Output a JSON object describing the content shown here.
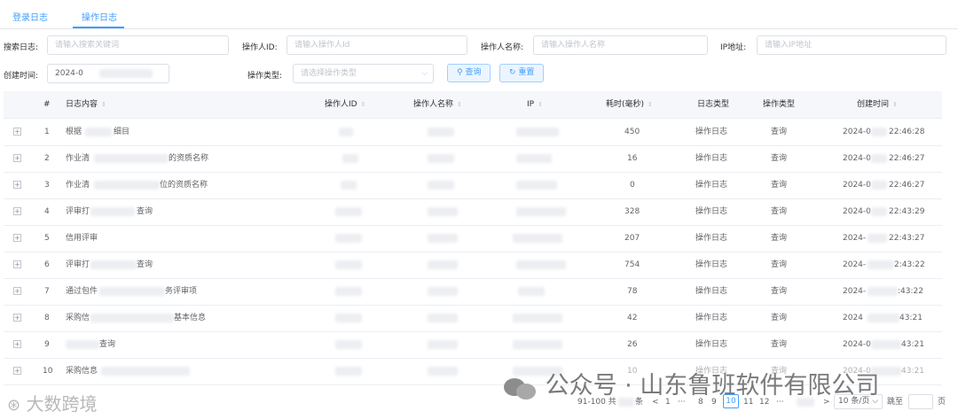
{
  "tabs": [
    "登录日志",
    "操作日志"
  ],
  "filters": {
    "search_label": "搜索日志:",
    "search_placeholder": "请输入搜索关键词",
    "operator_id_label": "操作人ID:",
    "operator_id_placeholder": "请输入操作人Id",
    "operator_name_label": "操作人名称:",
    "operator_name_placeholder": "请输入操作人名称",
    "ip_label": "IP地址:",
    "ip_placeholder": "请输入IP地址",
    "created_label": "创建时间:",
    "created_value": "2024-0",
    "op_type_label": "操作类型:",
    "op_type_placeholder": "请选择操作类型",
    "query_button": "查询",
    "reset_button": "重置"
  },
  "table": {
    "headers": [
      "#",
      "日志内容",
      "操作人ID",
      "操作人名称",
      "IP",
      "耗时(毫秒)",
      "日志类型",
      "操作类型",
      "创建时间"
    ],
    "rows": [
      {
        "index": "1",
        "content": "根据",
        "content2": "细目",
        "duration": "450",
        "log_type": "操作日志",
        "op_type": "查询",
        "time_prefix": "2024-0",
        "time_suffix": "22:46:28"
      },
      {
        "index": "2",
        "content": "作业清",
        "content2": "的资质名称",
        "duration": "16",
        "log_type": "操作日志",
        "op_type": "查询",
        "time_prefix": "2024-0",
        "time_suffix": "22:46:27"
      },
      {
        "index": "3",
        "content": "作业清",
        "content2": "位的资质名称",
        "duration": "0",
        "log_type": "操作日志",
        "op_type": "查询",
        "time_prefix": "2024-0",
        "time_suffix": "22:46:27"
      },
      {
        "index": "4",
        "content": "评审打",
        "content2": "查询",
        "duration": "328",
        "log_type": "操作日志",
        "op_type": "查询",
        "time_prefix": "2024-0",
        "time_suffix": "22:43:29"
      },
      {
        "index": "5",
        "content": "信用评审",
        "content2": "",
        "duration": "207",
        "log_type": "操作日志",
        "op_type": "查询",
        "time_prefix": "2024-",
        "time_suffix": "22:43:27"
      },
      {
        "index": "6",
        "content": "评审打",
        "content2": "查询",
        "duration": "754",
        "log_type": "操作日志",
        "op_type": "查询",
        "time_prefix": "2024-",
        "time_suffix": "2:43:22"
      },
      {
        "index": "7",
        "content": "通过包件",
        "content2": "务评审项",
        "duration": "78",
        "log_type": "操作日志",
        "op_type": "查询",
        "time_prefix": "2024-",
        "time_suffix": ":43:22"
      },
      {
        "index": "8",
        "content": "采购信",
        "content2": "基本信息",
        "duration": "42",
        "log_type": "操作日志",
        "op_type": "查询",
        "time_prefix": "2024",
        "time_suffix": "43:21"
      },
      {
        "index": "9",
        "content": "",
        "content2": "查询",
        "duration": "26",
        "log_type": "操作日志",
        "op_type": "查询",
        "time_prefix": "2024-0",
        "time_suffix": "43:21"
      },
      {
        "index": "10",
        "content": "采购信息",
        "content2": "",
        "duration": "10",
        "log_type": "操作日志",
        "op_type": "查询",
        "time_prefix": "2024-0",
        "time_suffix": "43:21"
      }
    ]
  },
  "pagination": {
    "range_text": "91-100 共",
    "total_suffix": "条",
    "prev": "<",
    "pages": [
      "1",
      "···",
      "8",
      "9",
      "10",
      "11",
      "12",
      "···"
    ],
    "active_page": "10",
    "next": ">",
    "page_size": "10 条/页",
    "jump_label": "跳至",
    "jump_suffix": "页"
  },
  "watermarks": {
    "left": "大数跨境",
    "right": "公众号 · 山东鲁班软件有限公司"
  },
  "colors": {
    "accent": "#409eff",
    "header_bg": "#f5f7fa",
    "border": "#ebeef5"
  }
}
